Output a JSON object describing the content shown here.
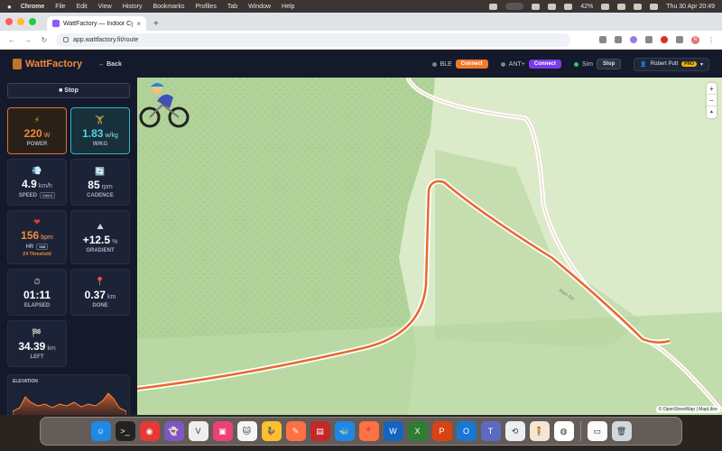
{
  "menubar": {
    "app_name": "Chrome",
    "menus": [
      "File",
      "Edit",
      "View",
      "History",
      "Bookmarks",
      "Profiles",
      "Tab",
      "Window",
      "Help"
    ],
    "battery": "42%",
    "datetime": "Thu 30 Apr  20:49"
  },
  "browser": {
    "tab_title": "WattFactory — Indoor Cycle",
    "url": "app.wattfactory.fit/route",
    "profile_initial": "R"
  },
  "header": {
    "logo": "WattFactory",
    "back_label": "← Back",
    "ble_label": "BLE",
    "ble_button": "Connect",
    "ant_label": "ANT+",
    "ant_button": "Connect",
    "sim_label": "Sim",
    "sim_button": "Stop",
    "user_name": "Robert Putt",
    "user_badge": "PRO"
  },
  "sidebar": {
    "stop_label": "■ Stop",
    "metrics": {
      "power": {
        "value": "220",
        "unit": "W",
        "label": "POWER"
      },
      "wkg": {
        "value": "1.83",
        "unit": "w/kg",
        "label": "W/KG"
      },
      "speed": {
        "value": "4.9",
        "unit": "km/h",
        "label": "SPEED",
        "tag": "CALC"
      },
      "cadence": {
        "value": "85",
        "unit": "rpm",
        "label": "CADENCE"
      },
      "hr": {
        "value": "156",
        "unit": "bpm",
        "label": "HR",
        "tag": "SIM",
        "zone": "Z4 Threshold"
      },
      "gradient": {
        "value": "+12.5",
        "unit": "%",
        "label": "GRADIENT"
      },
      "elapsed": {
        "value": "01:11",
        "label": "ELAPSED"
      },
      "done": {
        "value": "0.37",
        "unit": "km",
        "label": "DONE"
      },
      "left": {
        "value": "34.39",
        "unit": "km",
        "label": "LEFT"
      }
    },
    "elevation_title": "ELEVATION"
  },
  "map": {
    "zoom_in": "+",
    "zoom_out": "−",
    "compass": "▲",
    "road_label": "Main Rd",
    "attribution": "© OpenStreetMap | MapLibre"
  },
  "colors": {
    "accent_orange": "#f08a3c",
    "accent_cyan": "#53d3e0",
    "panel_bg": "#141a2b",
    "route": "#e8692c"
  },
  "dock": {
    "apps": [
      "finder-icon",
      "terminal-icon",
      "chrome-icon",
      "ghost-icon",
      "vim-icon",
      "preview-icon",
      "cat-icon",
      "duck-icon",
      "pen-icon",
      "redis-icon",
      "docker-icon",
      "pin-icon",
      "word-icon",
      "excel-icon",
      "powerpoint-icon",
      "outlook-icon",
      "teams-icon",
      "timemachine-icon",
      "person-icon",
      "basketball-icon",
      "document-icon",
      "trash-icon"
    ]
  }
}
